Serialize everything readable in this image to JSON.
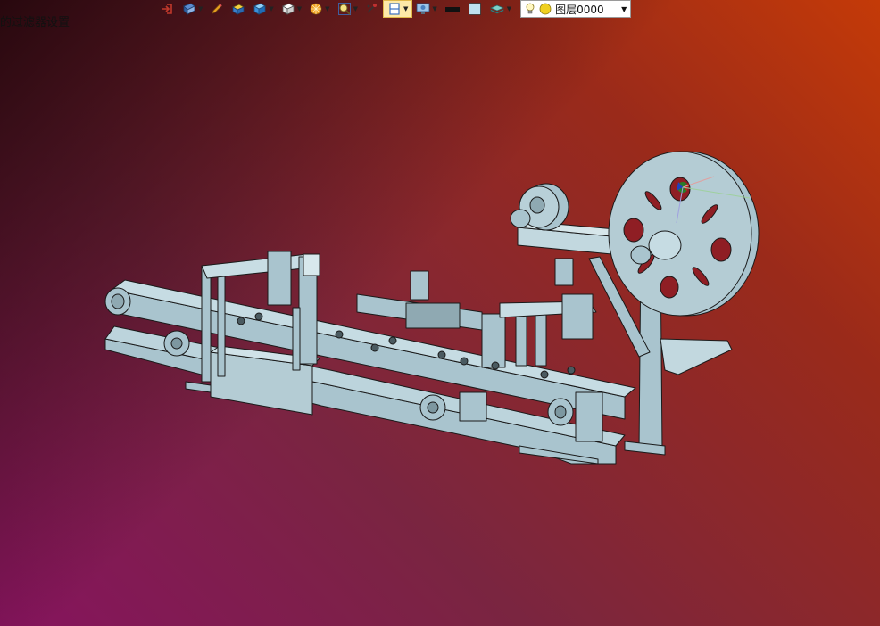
{
  "viewport": {
    "background_colors": [
      "#86145e",
      "#2a0a10",
      "#c43a08",
      "#7a5050"
    ],
    "filter_label": "的过滤器设置"
  },
  "toolbar": {
    "buttons": [
      {
        "icon": "exit-icon",
        "color": "#c0392b"
      },
      {
        "icon": "view-icon",
        "color": "#2e5e9e",
        "caret": true
      },
      {
        "icon": "pencil-icon",
        "color": "#e8a020"
      },
      {
        "icon": "shaded-box-icon",
        "color": "#e0b020"
      },
      {
        "icon": "cube-icon",
        "color": "#3a8fd8",
        "caret": true
      },
      {
        "icon": "white-cube-icon",
        "color": "#ffffff",
        "caret": true
      },
      {
        "icon": "sun-icon",
        "color": "#f0a020",
        "caret": true
      },
      {
        "icon": "zoom-icon",
        "color": "#e8c040",
        "caret": true
      },
      {
        "icon": "fit-view-icon",
        "color": "#333333"
      },
      {
        "icon": "section-view-icon",
        "color": "#3a70c0",
        "caret": true,
        "active": true
      },
      {
        "icon": "display-icon",
        "color": "#4a80c0",
        "caret": true
      },
      {
        "icon": "line-color-icon",
        "color": "#111111"
      },
      {
        "icon": "fill-icon",
        "color": "#bfe0ee"
      },
      {
        "icon": "layer-stack-icon",
        "color": "#40a0a0",
        "caret": true
      }
    ],
    "layer": {
      "bulb_icon": "lightbulb-icon",
      "status_icon": "circle-icon",
      "status_color": "#f0d020",
      "name": "图层0000"
    }
  },
  "model": {
    "name": "automated-assembly-machine",
    "body_color": "#a9c4ce",
    "edge_color": "#1a1a1a"
  }
}
